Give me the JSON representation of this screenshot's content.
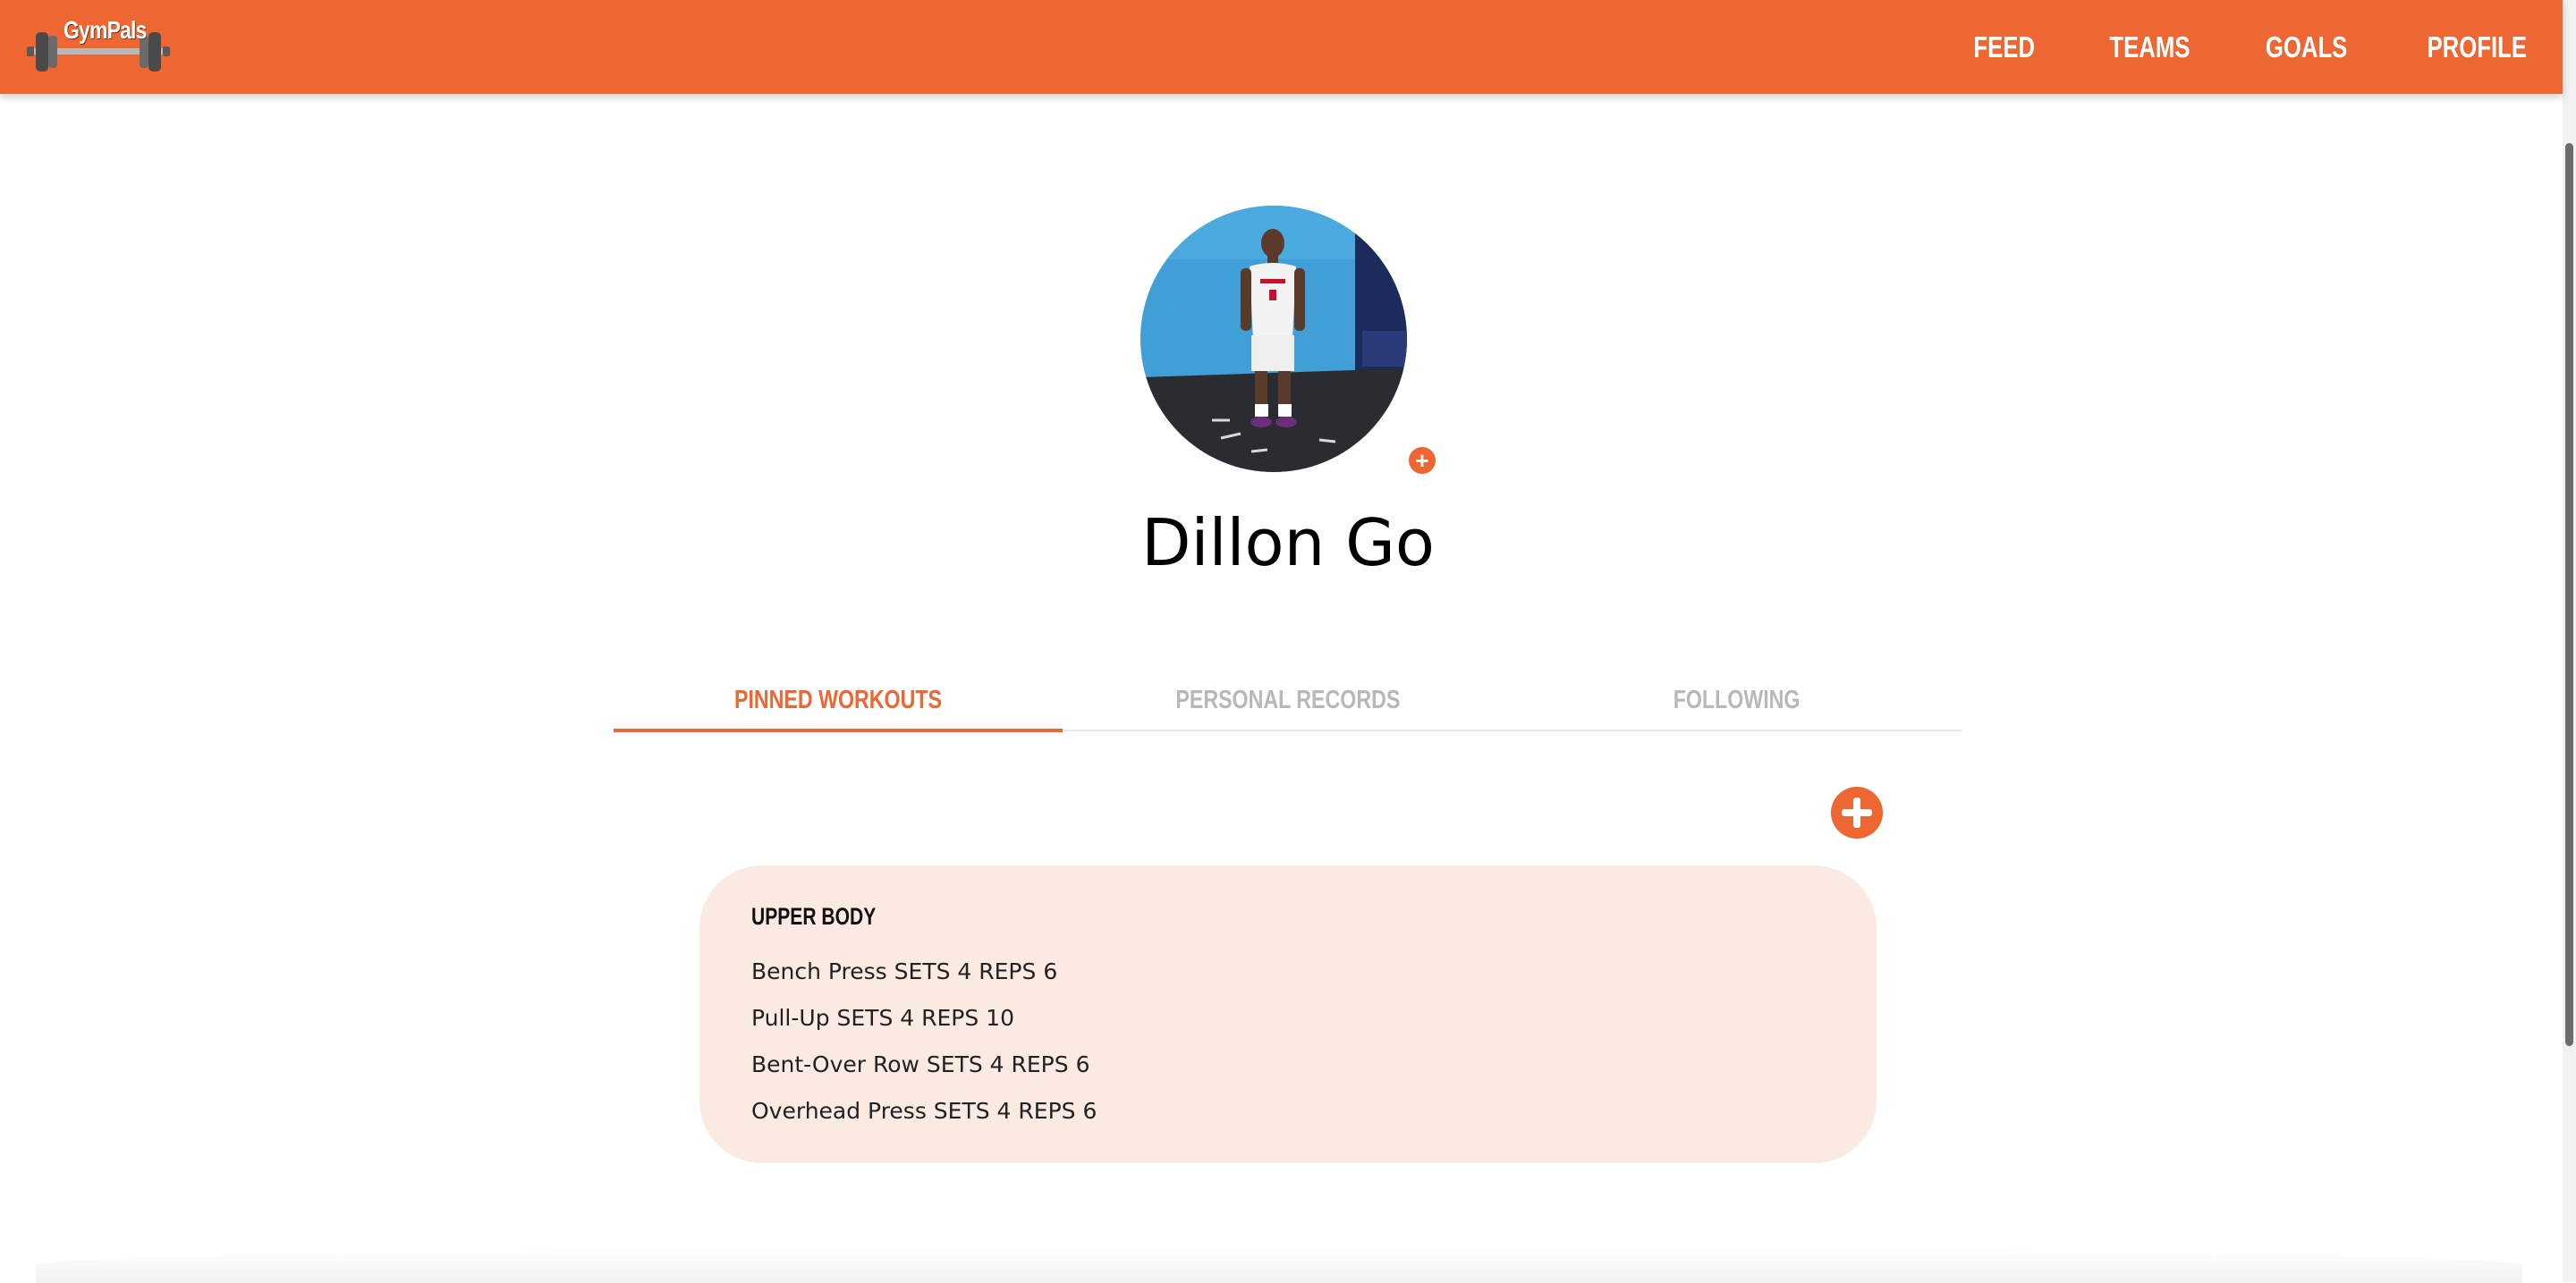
{
  "app": {
    "logo_text": "GymPals"
  },
  "nav": {
    "items": [
      {
        "label": "FEED"
      },
      {
        "label": "TEAMS"
      },
      {
        "label": "GOALS"
      },
      {
        "label": "PROFILE"
      }
    ]
  },
  "profile": {
    "name": "Dillon Go",
    "add_photo_icon": "plus-icon"
  },
  "tabs": [
    {
      "label": "PINNED WORKOUTS",
      "active": true
    },
    {
      "label": "PERSONAL RECORDS",
      "active": false
    },
    {
      "label": "FOLLOWING",
      "active": false
    }
  ],
  "workouts": [
    {
      "title": "UPPER BODY",
      "exercises": [
        "Bench Press SETS 4 REPS 6",
        "Pull-Up SETS 4 REPS 10",
        "Bent-Over Row SETS 4 REPS 6",
        "Overhead Press SETS 4 REPS 6"
      ]
    }
  ],
  "colors": {
    "accent": "#ee6631",
    "card_bg": "#fbeae1",
    "inactive_tab": "#b8b8b8"
  }
}
